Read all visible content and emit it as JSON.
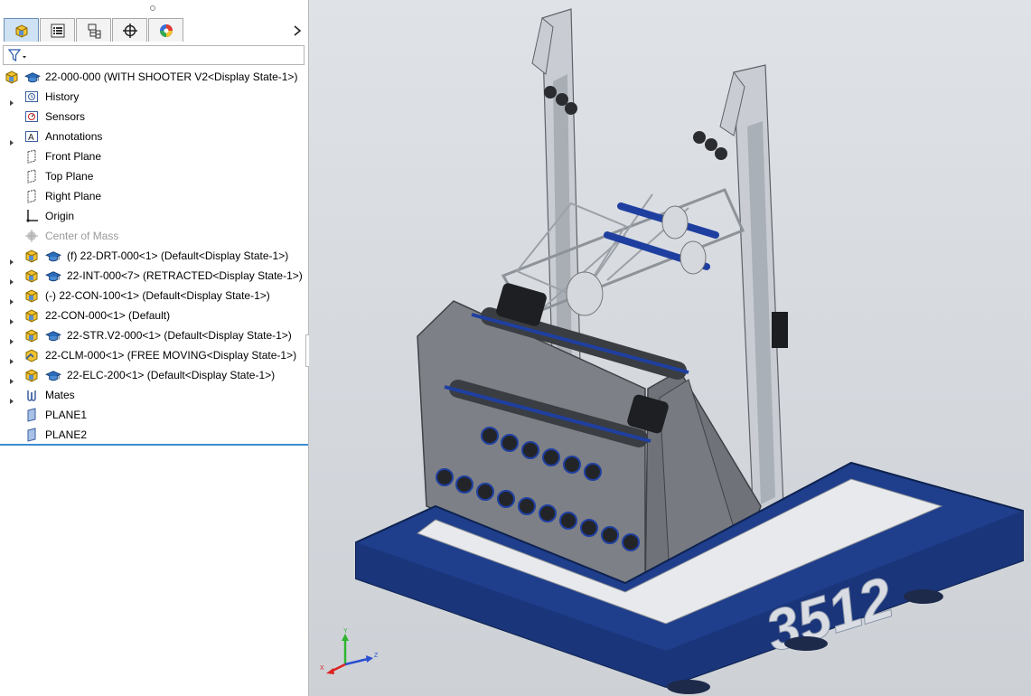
{
  "tabs": [
    {
      "name": "tab-feature-manager",
      "icon": "assembly-icon",
      "active": true
    },
    {
      "name": "tab-property-manager",
      "icon": "property-list-icon",
      "active": false
    },
    {
      "name": "tab-configuration-manager",
      "icon": "configuration-icon",
      "active": false
    },
    {
      "name": "tab-dimxpert-manager",
      "icon": "crosshair-icon",
      "active": false
    },
    {
      "name": "tab-display-manager",
      "icon": "color-wheel-icon",
      "active": false
    }
  ],
  "filter": {
    "icon": "filter-icon"
  },
  "tree": {
    "root": {
      "label": "22-000-000  (WITH SHOOTER V2<Display State-1>)"
    },
    "items": [
      {
        "label": "History",
        "icon": "history-icon",
        "expandable": true
      },
      {
        "label": "Sensors",
        "icon": "sensors-icon",
        "expandable": false
      },
      {
        "label": "Annotations",
        "icon": "annotations-icon",
        "expandable": true
      },
      {
        "label": "Front Plane",
        "icon": "plane-icon",
        "expandable": false
      },
      {
        "label": "Top Plane",
        "icon": "plane-icon",
        "expandable": false
      },
      {
        "label": "Right Plane",
        "icon": "plane-icon",
        "expandable": false
      },
      {
        "label": "Origin",
        "icon": "origin-icon",
        "expandable": false
      },
      {
        "label": "Center of Mass",
        "icon": "center-of-mass-icon",
        "expandable": false,
        "dim": true
      },
      {
        "label": "(f) 22-DRT-000<1> (Default<Display State-1>)",
        "icon": "subassembly-icon",
        "expandable": true,
        "cap": true
      },
      {
        "label": "22-INT-000<7> (RETRACTED<Display State-1>)",
        "icon": "subassembly-icon",
        "expandable": true,
        "cap": true
      },
      {
        "label": "(-) 22-CON-100<1> (Default<Display State-1>)",
        "icon": "subassembly-icon",
        "expandable": true,
        "cap": false
      },
      {
        "label": "22-CON-000<1> (Default)",
        "icon": "subassembly-icon",
        "expandable": true,
        "cap": false
      },
      {
        "label": "22-STR.V2-000<1> (Default<Display State-1>)",
        "icon": "subassembly-icon",
        "expandable": true,
        "cap": true
      },
      {
        "label": "22-CLM-000<1> (FREE MOVING<Display State-1>)",
        "icon": "flexible-subassembly-icon",
        "expandable": true,
        "cap": false
      },
      {
        "label": "22-ELC-200<1> (Default<Display State-1>)",
        "icon": "subassembly-icon",
        "expandable": true,
        "cap": true
      },
      {
        "label": "Mates",
        "icon": "mates-icon",
        "expandable": true
      },
      {
        "label": "PLANE1",
        "icon": "plane-solid-icon",
        "expandable": false
      },
      {
        "label": "PLANE2",
        "icon": "plane-solid-icon",
        "expandable": false
      }
    ]
  },
  "viewport": {
    "bumper_text": "3512",
    "triad": {
      "x_label": "X",
      "y_label": "Y",
      "z_label": "Z"
    },
    "colors": {
      "bumper": "#1f3e8c",
      "frame": "#c8ccd2",
      "plate": "#7d8086",
      "roller": "#3a3d42",
      "accent": "#1f3fa0"
    }
  }
}
